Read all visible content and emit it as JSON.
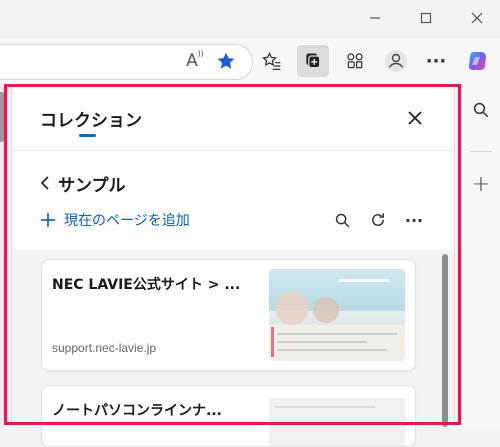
{
  "browser": {
    "window_controls": {
      "minimize": "minimize-icon",
      "maximize": "maximize-icon",
      "close": "close-icon"
    },
    "toolbar_icons": [
      "read-aloud-icon",
      "favorite-star-icon",
      "favorites-list-icon",
      "collections-icon",
      "extensions-icon",
      "profile-icon",
      "more-icon",
      "copilot-icon"
    ],
    "read_aloud_glyph": "A",
    "more_glyph": "···",
    "accent_color": "#0f6cbd",
    "star_color": "#1a5fd6"
  },
  "side_bar": {
    "search_glyph": "⌕",
    "add_glyph": "+"
  },
  "collections_panel": {
    "title": "コレクション",
    "close_glyph": "✕",
    "collection": {
      "back_glyph": "‹",
      "name": "サンプル",
      "add_icon": "+",
      "add_current_page_label": "現在のページを追加",
      "actions": [
        "search-icon",
        "refresh-icon",
        "more-icon"
      ],
      "more_glyph": "···"
    },
    "items": [
      {
        "title": "NEC LAVIE公式サイト > ...",
        "url": "support.nec-lavie.jp"
      },
      {
        "title": "ノートパソコンラインナ...",
        "url": ""
      }
    ],
    "highlight_color": "#e6194b"
  }
}
